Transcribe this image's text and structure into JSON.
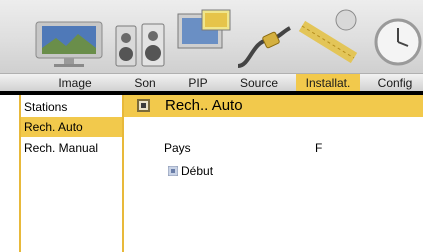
{
  "menu": {
    "tabs": [
      {
        "label": "Image"
      },
      {
        "label": "Son"
      },
      {
        "label": "PIP"
      },
      {
        "label": "Source"
      },
      {
        "label": "Installat."
      },
      {
        "label": "Config"
      }
    ],
    "active_tab": "Installat."
  },
  "sidebar": {
    "items": [
      {
        "label": "Stations"
      },
      {
        "label": "Rech. Auto"
      },
      {
        "label": "Rech. Manual"
      }
    ],
    "selected": "Rech. Auto"
  },
  "content": {
    "title": "Rech.. Auto",
    "pays_label": "Pays",
    "pays_value": "F",
    "start_label": "Début"
  },
  "colors": {
    "accent": "#f2c94c",
    "separator": "#000000"
  }
}
